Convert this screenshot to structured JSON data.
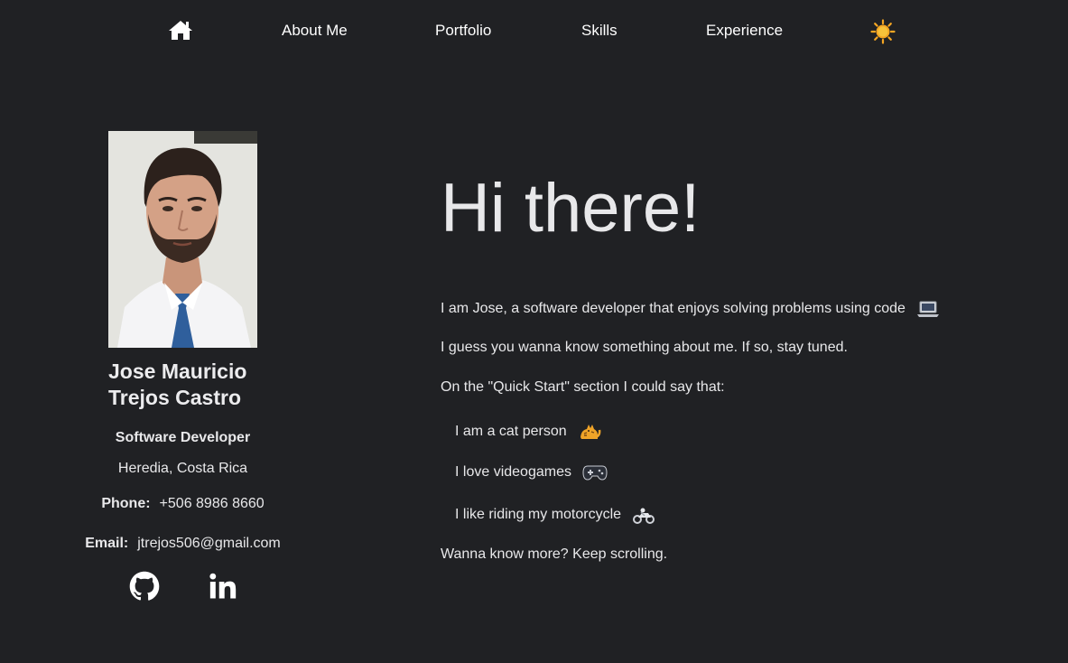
{
  "nav": {
    "home_icon": "home-icon",
    "items": [
      {
        "label": "About Me"
      },
      {
        "label": "Portfolio"
      },
      {
        "label": "Skills"
      },
      {
        "label": "Experience"
      }
    ],
    "theme_icon": "sun-icon",
    "theme_color": "#f5a623"
  },
  "profile": {
    "name_line1": "Jose Mauricio",
    "name_line2": "Trejos Castro",
    "role": "Software Developer",
    "location": "Heredia, Costa Rica",
    "phone_label": "Phone:",
    "phone": "+506 8986 8660",
    "email_label": "Email:",
    "email": "jtrejos506@gmail.com",
    "social": [
      "github-icon",
      "linkedin-icon"
    ]
  },
  "intro": {
    "heading": "Hi there!",
    "line1": "I am Jose, a software developer that enjoys solving problems using code",
    "line1_icon": "laptop-icon",
    "line2": "I guess you wanna know something about me. If so, stay tuned.",
    "line3": "On the \"Quick Start\" section I could say that:",
    "facts": [
      {
        "text": "I am a cat person",
        "icon": "cat-icon"
      },
      {
        "text": "I love videogames",
        "icon": "gamepad-icon"
      },
      {
        "text": "I like riding my motorcycle",
        "icon": "motorcycle-icon"
      }
    ],
    "closing": "Wanna know more? Keep scrolling."
  }
}
